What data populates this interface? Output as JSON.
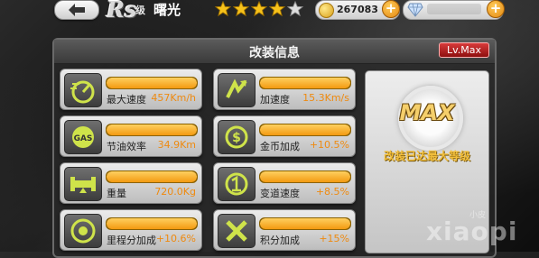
{
  "header": {
    "rank": "Rs",
    "rank_suffix": "级",
    "car_name": "曙光",
    "stars_filled": 4,
    "stars_total": 5,
    "coins": "267083",
    "coin_icon": "coin-icon",
    "gem_icon": "diamond-icon"
  },
  "panel": {
    "title": "改装信息",
    "level_badge": "Lv.Max"
  },
  "stats": [
    {
      "icon": "speedometer-icon",
      "label": "最大速度",
      "value": "457Km/h",
      "fill": 1.0
    },
    {
      "icon": "acceleration-icon",
      "label": "加速度",
      "value": "15.3Km/s",
      "fill": 1.0
    },
    {
      "icon": "gas-icon",
      "label": "节油效率",
      "value": "34.9Km",
      "fill": 1.0
    },
    {
      "icon": "coin-bonus-icon",
      "label": "金币加成",
      "value": "+10.5%",
      "fill": 1.0
    },
    {
      "icon": "weight-icon",
      "label": "重量",
      "value": "720.0Kg",
      "fill": 1.0
    },
    {
      "icon": "shift-speed-icon",
      "label": "变道速度",
      "value": "+8.5%",
      "fill": 1.0
    },
    {
      "icon": "mileage-icon",
      "label": "里程分加成",
      "value": "+10.6%",
      "fill": 1.0
    },
    {
      "icon": "score-icon",
      "label": "积分加成",
      "value": "+15%",
      "fill": 1.0
    }
  ],
  "max": {
    "badge": "MAX",
    "note": "改装已达最大等级"
  },
  "watermark": {
    "text": "xiaopi",
    "sub": "小皮"
  },
  "colors": {
    "accent_orange": "#f39a10",
    "badge_red": "#c82020",
    "gold": "#f5cf6b"
  }
}
